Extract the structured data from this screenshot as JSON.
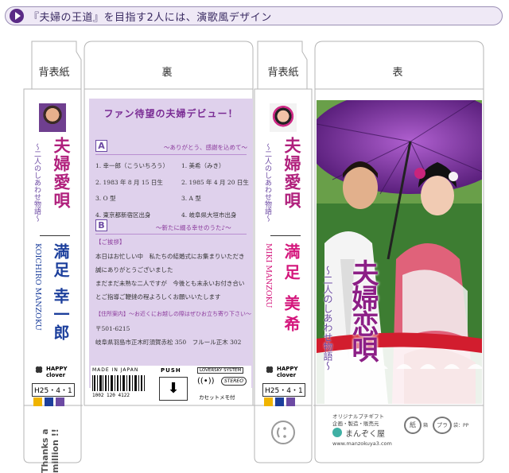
{
  "header": {
    "title": "『夫婦の王道』を目指す2人には、演歌風デザイン"
  },
  "panels": {
    "spine_left_label": "背表紙",
    "back_label": "裏",
    "spine_right_label": "背表紙",
    "front_label": "表"
  },
  "left_spine": {
    "song_title": "夫婦愛唄",
    "subtitle": "〜二人のしあわせ物語〜",
    "romaji": "KOICHIRO MANZOKU",
    "name": "満足 幸一郎",
    "brand": "HAPPY clover",
    "date": "H25・4・1",
    "tab_text": "Thanks a million !!"
  },
  "right_spine": {
    "song_title": "夫婦愛唄",
    "subtitle": "〜二人のしあわせ物語〜",
    "romaji": "MIKI MANZOKU",
    "name": "満足 美希",
    "brand": "HAPPY clover",
    "date": "H25・4・1"
  },
  "back": {
    "headline": "ファン待望の夫婦デビュー！",
    "block_a": {
      "label": "A",
      "caption": "〜ありがとう、感謝を込めて〜",
      "rows": [
        [
          "1. 幸一郎（こういちろう）",
          "1. 美希（みき）"
        ],
        [
          "2. 1983 年 8 月 15 日生",
          "2. 1985 年 4 月 20 日生"
        ],
        [
          "3. O 型",
          "3. A 型"
        ],
        [
          "4. 東京都新宿区出身",
          "4. 岐阜県大垣市出身"
        ]
      ]
    },
    "block_b": {
      "label": "B",
      "caption": "〜新たに綴る幸せのうた♪〜",
      "greeting_head": "【ご挨拶】",
      "greeting_lines": [
        "本日はお忙しい中　私たちの結婚式にお集まりいただき",
        "誠にありがとうございました",
        "まだまだ未熟な二人ですが　今後とも末永いお付き合い",
        "とご指導ご鞭撻の程よろしくお願いいたします"
      ],
      "address_head": "【住所案内】〜お近くにお越しの際はぜひお立ち寄り下さい〜",
      "postal": "〒501-6215",
      "address": "岐阜県羽島市正木町須賀赤松 350　フルール正木 302"
    },
    "footer": {
      "made_in": "MADE IN JAPAN",
      "barcode_digits": "1002 120 4122",
      "push_label": "PUSH",
      "lovesky": "LOVERSKY SYSTEM",
      "stereo": "STEREO",
      "memo": "カセットメモ付"
    }
  },
  "front": {
    "title": "夫婦恋唄",
    "subtitle": "〜二人のしあわせ物語〜"
  },
  "front_tab": {
    "line1": "オリジナルプチギフト",
    "line2": "企画・製造・販売元",
    "company": "まんぞく屋",
    "url": "www.manzokuya3.com",
    "recycle_paper": "紙",
    "recycle_plastic": "プラ",
    "paper_part": "箱",
    "plastic_part": "袋：PP"
  },
  "colors": {
    "accent_purple": "#5a2a86",
    "card_lavender": "#dfd1ec",
    "name_blue": "#1c3f9c",
    "name_pink": "#d4167c",
    "title_magenta": "#b0207c"
  }
}
